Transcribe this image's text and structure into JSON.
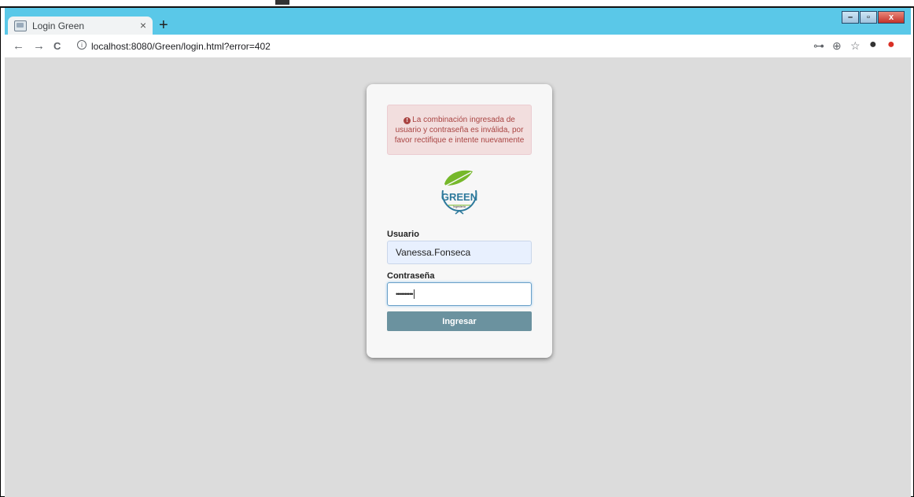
{
  "browser": {
    "tab_title": "Login Green",
    "tab_close": "×",
    "new_tab": "+",
    "url": "localhost:8080/Green/login.html?error=402",
    "info_glyph": "i",
    "back_glyph": "←",
    "forward_glyph": "→",
    "reload_glyph": "C",
    "key_glyph": "⊶",
    "zoom_glyph": "⊕",
    "star_glyph": "☆",
    "profile_glyph": "●",
    "ext_glyph": "●",
    "window_controls": {
      "minimize": "–",
      "maximize": "▫",
      "close": "x"
    },
    "accent_color": "#5ac8e8"
  },
  "login": {
    "alert_icon": "!",
    "alert_text": "La combinación ingresada de usuario y contraseña es inválida, por favor rectifique e intente nuevamente",
    "logo_text": "GREEN",
    "logo_subtext": "Ingeniería",
    "username_label": "Usuario",
    "username_value": "Vanessa.Fonseca",
    "password_label": "Contraseña",
    "password_value": "••••••••••",
    "submit_label": "Ingresar",
    "button_color": "#6b929f"
  }
}
